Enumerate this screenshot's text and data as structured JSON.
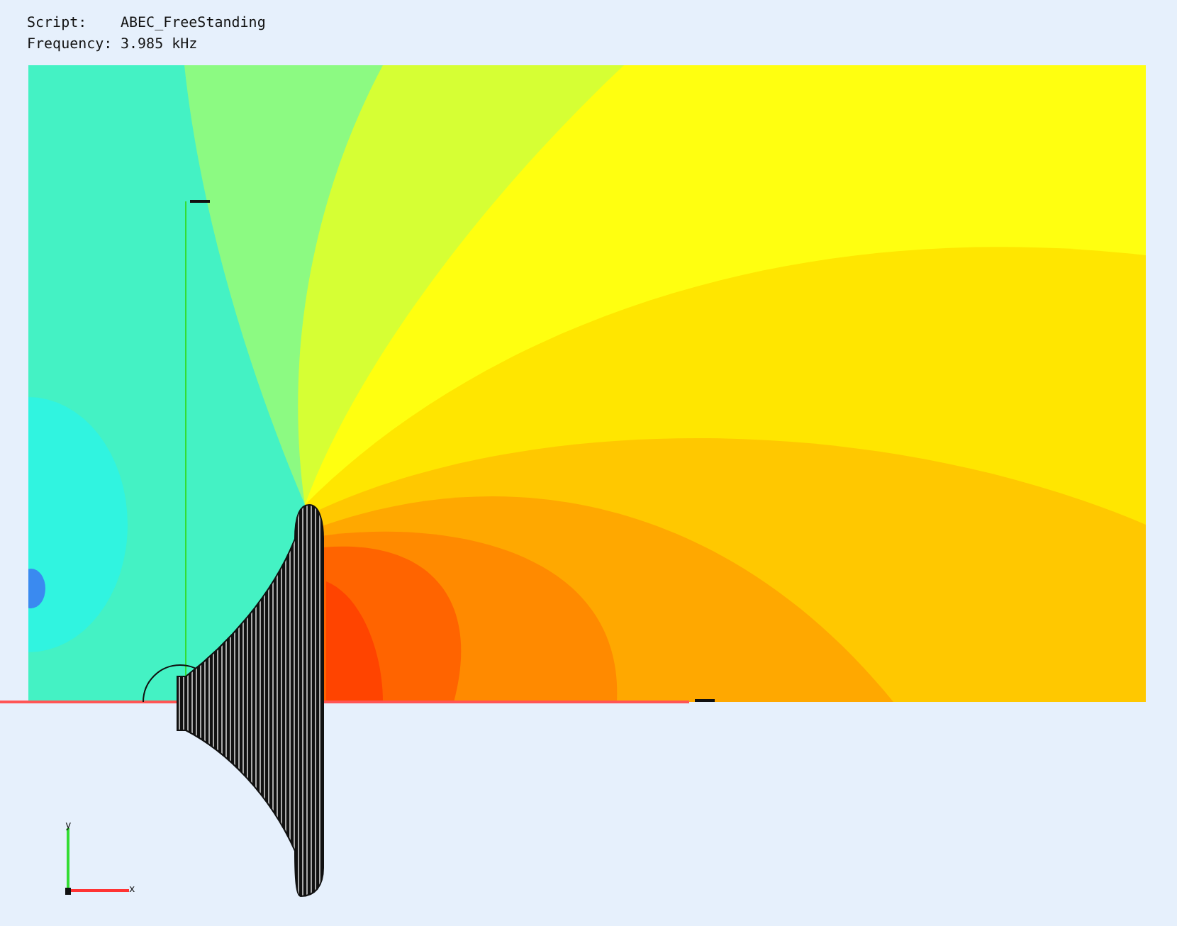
{
  "header": [
    {
      "label": "Script:",
      "value": "ABEC_FreeStanding"
    },
    {
      "label": "Frequency:",
      "value": "3.985 kHz"
    }
  ],
  "axes": {
    "y_label": "y",
    "x_label": "x"
  }
}
